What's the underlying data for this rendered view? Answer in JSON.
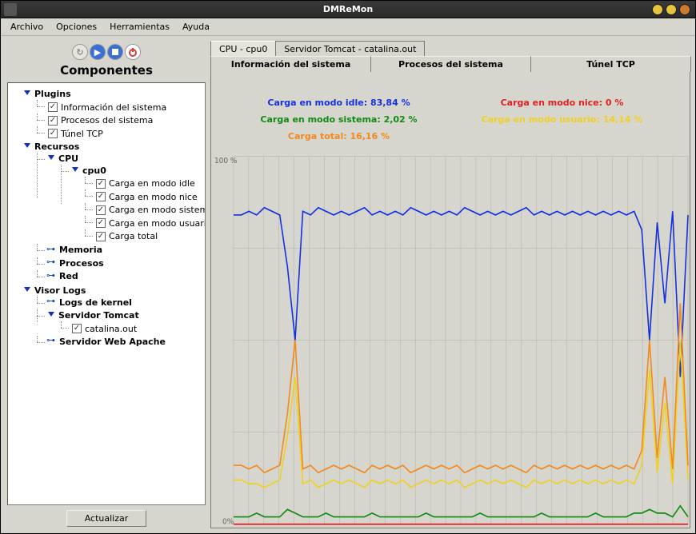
{
  "window": {
    "title": "DMReMon"
  },
  "menu": {
    "archivo": "Archivo",
    "opciones": "Opciones",
    "herramientas": "Herramientas",
    "ayuda": "Ayuda"
  },
  "sidebar": {
    "title": "Componentes",
    "update_btn": "Actualizar",
    "plugins": {
      "label": "Plugins",
      "items": [
        "Información del sistema",
        "Procesos del sistema",
        "Túnel TCP"
      ]
    },
    "recursos": {
      "label": "Recursos",
      "cpu": {
        "label": "CPU",
        "cpu0": {
          "label": "cpu0",
          "metrics": [
            "Carga en modo idle",
            "Carga en modo nice",
            "Carga en modo sistema",
            "Carga en modo usuario",
            "Carga total"
          ]
        }
      },
      "memoria": "Memoria",
      "procesos": "Procesos",
      "red": "Red"
    },
    "visor_logs": {
      "label": "Visor Logs",
      "kernel": "Logs de kernel",
      "tomcat": {
        "label": "Servidor Tomcat",
        "file": "catalina.out"
      },
      "apache": "Servidor Web Apache"
    }
  },
  "tabs": {
    "primary": [
      "CPU - cpu0",
      "Servidor Tomcat - catalina.out"
    ],
    "secondary": [
      "Información del sistema",
      "Procesos del sistema",
      "Túnel TCP"
    ]
  },
  "legend": {
    "idle": {
      "label": "Carga en modo idle: 83,84 %",
      "color": "#1530e0"
    },
    "nice": {
      "label": "Carga en modo nice: 0 %",
      "color": "#e02020"
    },
    "sistema": {
      "label": "Carga en modo sistema: 2,02 %",
      "color": "#108a10"
    },
    "usuario": {
      "label": "Carga en modo usuario: 14,14 %",
      "color": "#f0d020"
    },
    "total": {
      "label": "Carga total: 16,16 %",
      "color": "#f08a20"
    }
  },
  "chart_data": {
    "type": "line",
    "xlabel": "",
    "ylabel": "",
    "ylim": [
      0,
      100
    ],
    "y_ticks": [
      "0%",
      "100 %"
    ],
    "x_count": 60,
    "series": [
      {
        "name": "Carga en modo idle",
        "color": "#1530e0",
        "values": [
          84,
          84,
          85,
          84,
          86,
          85,
          84,
          70,
          50,
          85,
          84,
          86,
          85,
          84,
          85,
          84,
          85,
          86,
          84,
          85,
          84,
          85,
          84,
          86,
          85,
          84,
          85,
          84,
          85,
          84,
          86,
          85,
          84,
          85,
          84,
          85,
          84,
          85,
          86,
          84,
          85,
          84,
          85,
          84,
          85,
          84,
          85,
          84,
          85,
          84,
          85,
          84,
          85,
          80,
          50,
          82,
          60,
          85,
          40,
          84
        ]
      },
      {
        "name": "Carga en modo nice",
        "color": "#e02020",
        "values": [
          0,
          0,
          0,
          0,
          0,
          0,
          0,
          0,
          0,
          0,
          0,
          0,
          0,
          0,
          0,
          0,
          0,
          0,
          0,
          0,
          0,
          0,
          0,
          0,
          0,
          0,
          0,
          0,
          0,
          0,
          0,
          0,
          0,
          0,
          0,
          0,
          0,
          0,
          0,
          0,
          0,
          0,
          0,
          0,
          0,
          0,
          0,
          0,
          0,
          0,
          0,
          0,
          0,
          0,
          0,
          0,
          0,
          0,
          0,
          0
        ]
      },
      {
        "name": "Carga en modo sistema",
        "color": "#108a10",
        "values": [
          2,
          2,
          2,
          3,
          2,
          2,
          2,
          4,
          3,
          2,
          2,
          2,
          3,
          2,
          2,
          2,
          2,
          2,
          3,
          2,
          2,
          2,
          2,
          2,
          2,
          3,
          2,
          2,
          2,
          2,
          2,
          2,
          3,
          2,
          2,
          2,
          2,
          2,
          2,
          2,
          3,
          2,
          2,
          2,
          2,
          2,
          2,
          3,
          2,
          2,
          2,
          2,
          3,
          3,
          4,
          3,
          3,
          2,
          5,
          2
        ]
      },
      {
        "name": "Carga en modo usuario",
        "color": "#f0d020",
        "values": [
          12,
          12,
          11,
          11,
          10,
          11,
          12,
          24,
          40,
          11,
          12,
          10,
          11,
          12,
          11,
          12,
          11,
          10,
          12,
          11,
          12,
          11,
          12,
          10,
          11,
          12,
          11,
          12,
          11,
          12,
          10,
          11,
          12,
          11,
          12,
          11,
          12,
          11,
          10,
          12,
          11,
          12,
          11,
          12,
          11,
          12,
          11,
          12,
          11,
          12,
          11,
          12,
          11,
          16,
          42,
          14,
          33,
          11,
          50,
          12
        ]
      },
      {
        "name": "Carga total",
        "color": "#f08a20",
        "values": [
          16,
          16,
          15,
          16,
          14,
          15,
          16,
          30,
          50,
          15,
          16,
          14,
          15,
          16,
          15,
          16,
          15,
          14,
          16,
          15,
          16,
          15,
          16,
          14,
          15,
          16,
          15,
          16,
          15,
          16,
          14,
          15,
          16,
          15,
          16,
          15,
          16,
          15,
          14,
          16,
          15,
          16,
          15,
          16,
          15,
          16,
          15,
          16,
          15,
          16,
          15,
          16,
          15,
          20,
          50,
          18,
          40,
          15,
          60,
          16
        ]
      }
    ]
  }
}
